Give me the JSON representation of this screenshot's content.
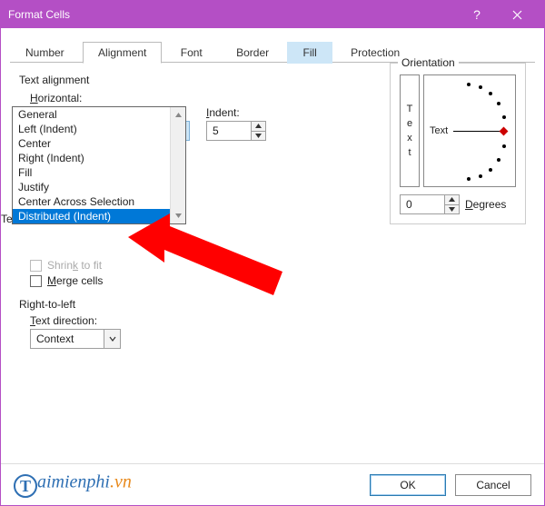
{
  "titlebar": {
    "title": "Format Cells"
  },
  "tabs": [
    "Number",
    "Alignment",
    "Font",
    "Border",
    "Fill",
    "Protection"
  ],
  "textAlignment": {
    "groupLabel": "Text alignment",
    "horizontalLabelPrefix": "H",
    "horizontalLabel": "orizontal:",
    "horizontalValue": "Distributed (Indent)",
    "indentLabelPrefix": "I",
    "indentLabel": "ndent:",
    "indentValue": "5",
    "options": [
      "General",
      "Left (Indent)",
      "Center",
      "Right (Indent)",
      "Fill",
      "Justify",
      "Center Across Selection",
      "Distributed (Indent)"
    ]
  },
  "textControl": {
    "groupLabelPrefix": "Te",
    "shrinkLabelPrefix": "Shrin",
    "shrinkLabelU": "k",
    "shrinkLabelSuffix": " to fit",
    "mergeLabelU": "M",
    "mergeLabelSuffix": "erge cells"
  },
  "rtl": {
    "groupLabel": "Right-to-left",
    "textDirLabelPrefix": "T",
    "textDirLabel": "ext direction:",
    "textDirValue": "Context"
  },
  "orientation": {
    "legend": "Orientation",
    "vertChars": [
      "T",
      "e",
      "x",
      "t"
    ],
    "dialLabel": "Text",
    "degreesValue": "0",
    "degreesLabelU": "D",
    "degreesLabelSuffix": "egrees"
  },
  "buttons": {
    "ok": "OK",
    "cancel": "Cancel"
  },
  "watermark": {
    "cap": "T",
    "mid": "aimienphi",
    "suffix": ".vn"
  }
}
